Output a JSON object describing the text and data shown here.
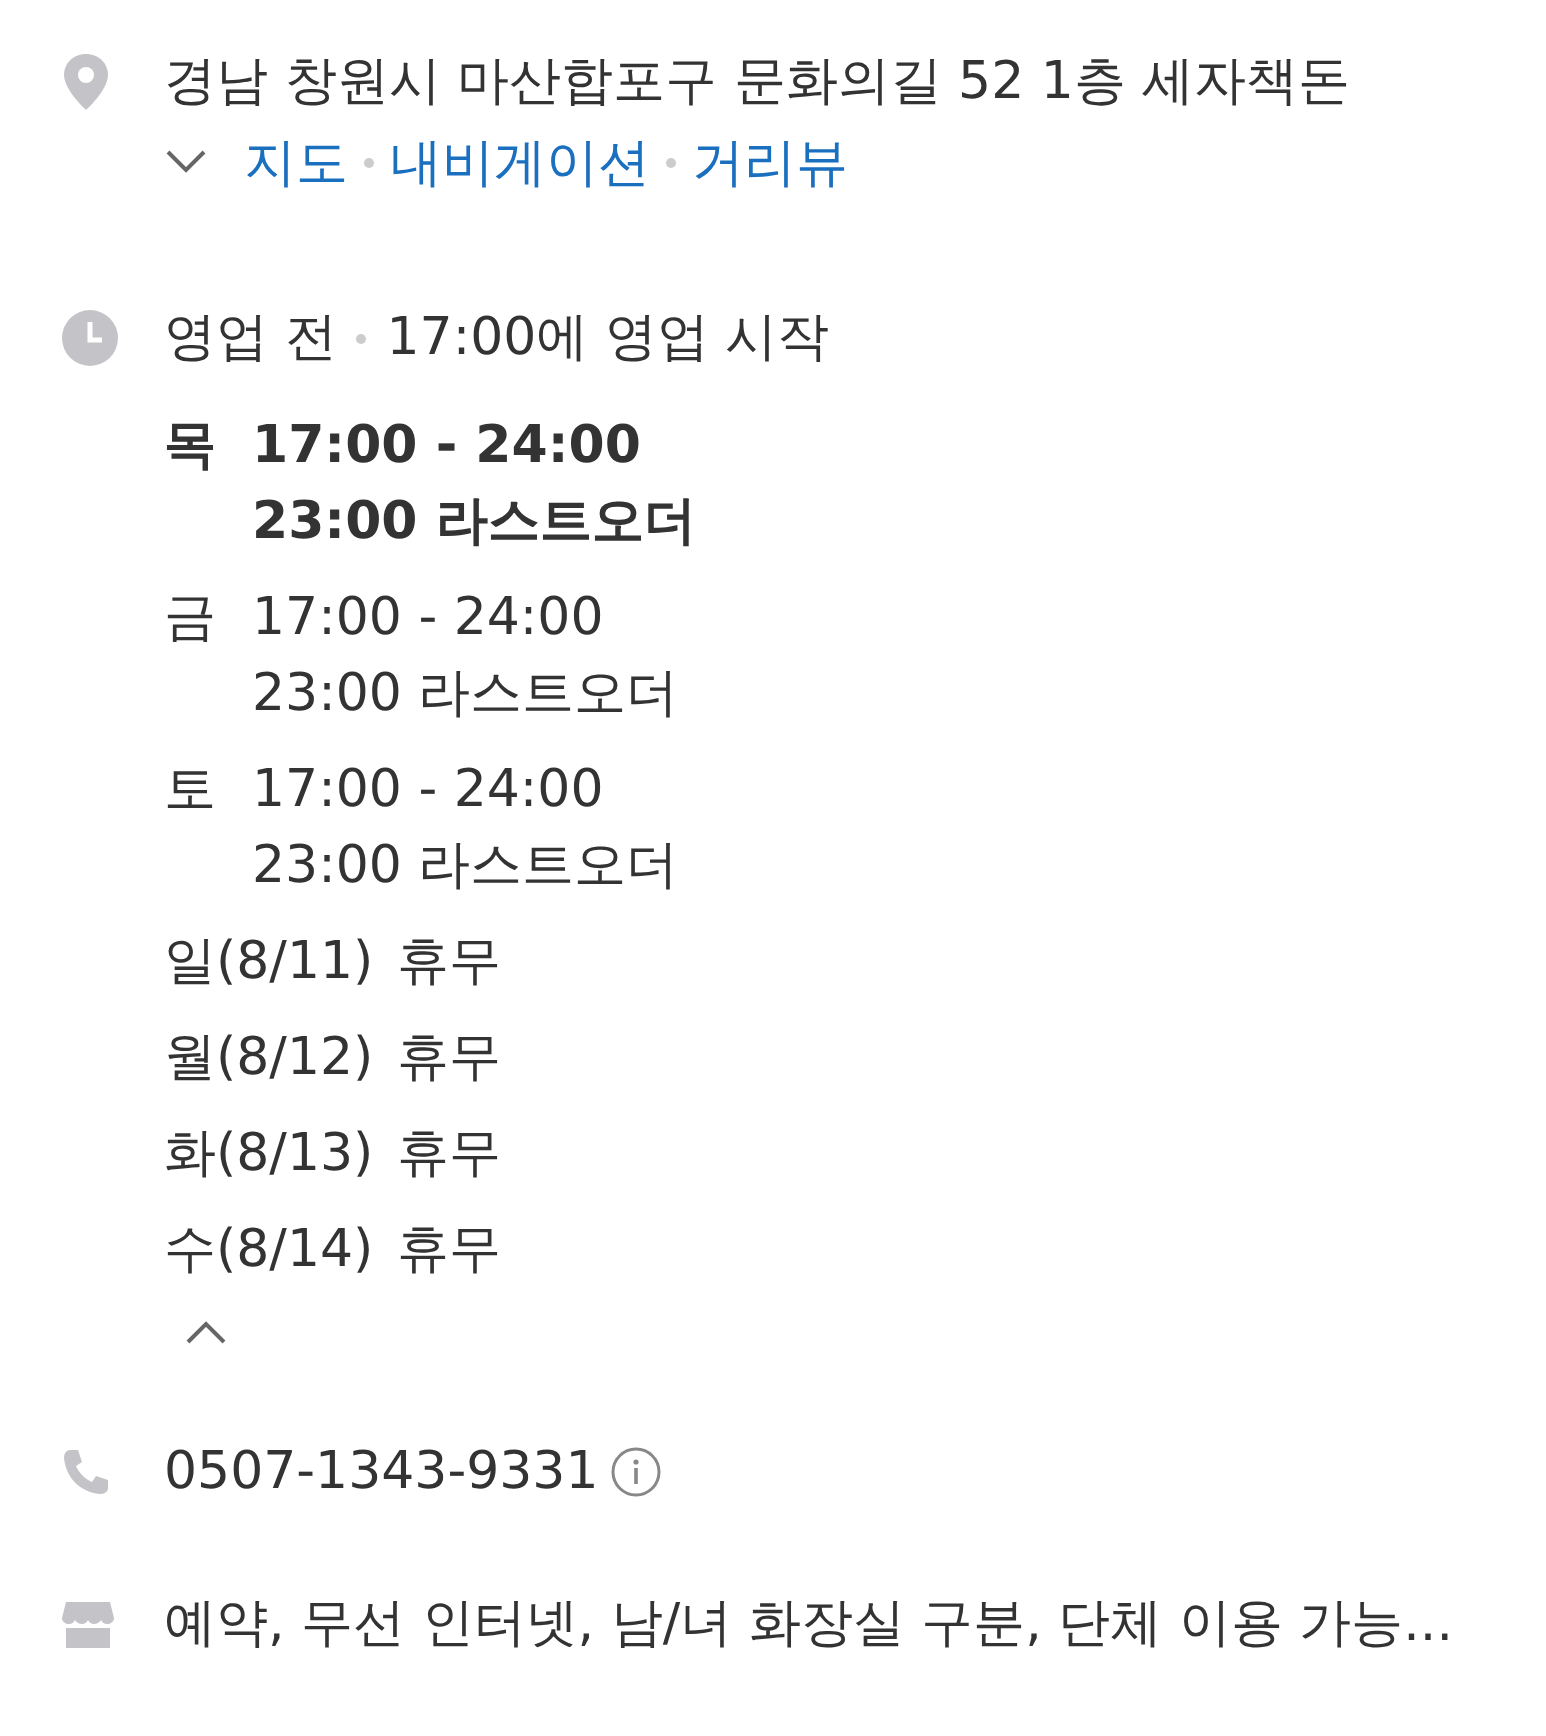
{
  "address": {
    "text": "경남 창원시 마산합포구 문화의길 52 1층 세자책돈",
    "expanded": false,
    "links": [
      "지도",
      "내비게이션",
      "거리뷰"
    ]
  },
  "hours": {
    "status": "영업 전",
    "detail": "17:00에 영업 시작",
    "expanded": true,
    "days": [
      {
        "day": "목",
        "time": "17:00 - 24:00",
        "note": "23:00 라스트오더",
        "today": true
      },
      {
        "day": "금",
        "time": "17:00 - 24:00",
        "note": "23:00 라스트오더",
        "today": false
      },
      {
        "day": "토",
        "time": "17:00 - 24:00",
        "note": "23:00 라스트오더",
        "today": false
      },
      {
        "day": "일(8/11)",
        "time": "휴무",
        "today": false
      },
      {
        "day": "월(8/12)",
        "time": "휴무",
        "today": false
      },
      {
        "day": "화(8/13)",
        "time": "휴무",
        "today": false
      },
      {
        "day": "수(8/14)",
        "time": "휴무",
        "today": false
      }
    ]
  },
  "phone": "0507-1343-9331",
  "amenities": "예약, 무선 인터넷, 남/녀 화장실 구분, 단체 이용 가능..."
}
